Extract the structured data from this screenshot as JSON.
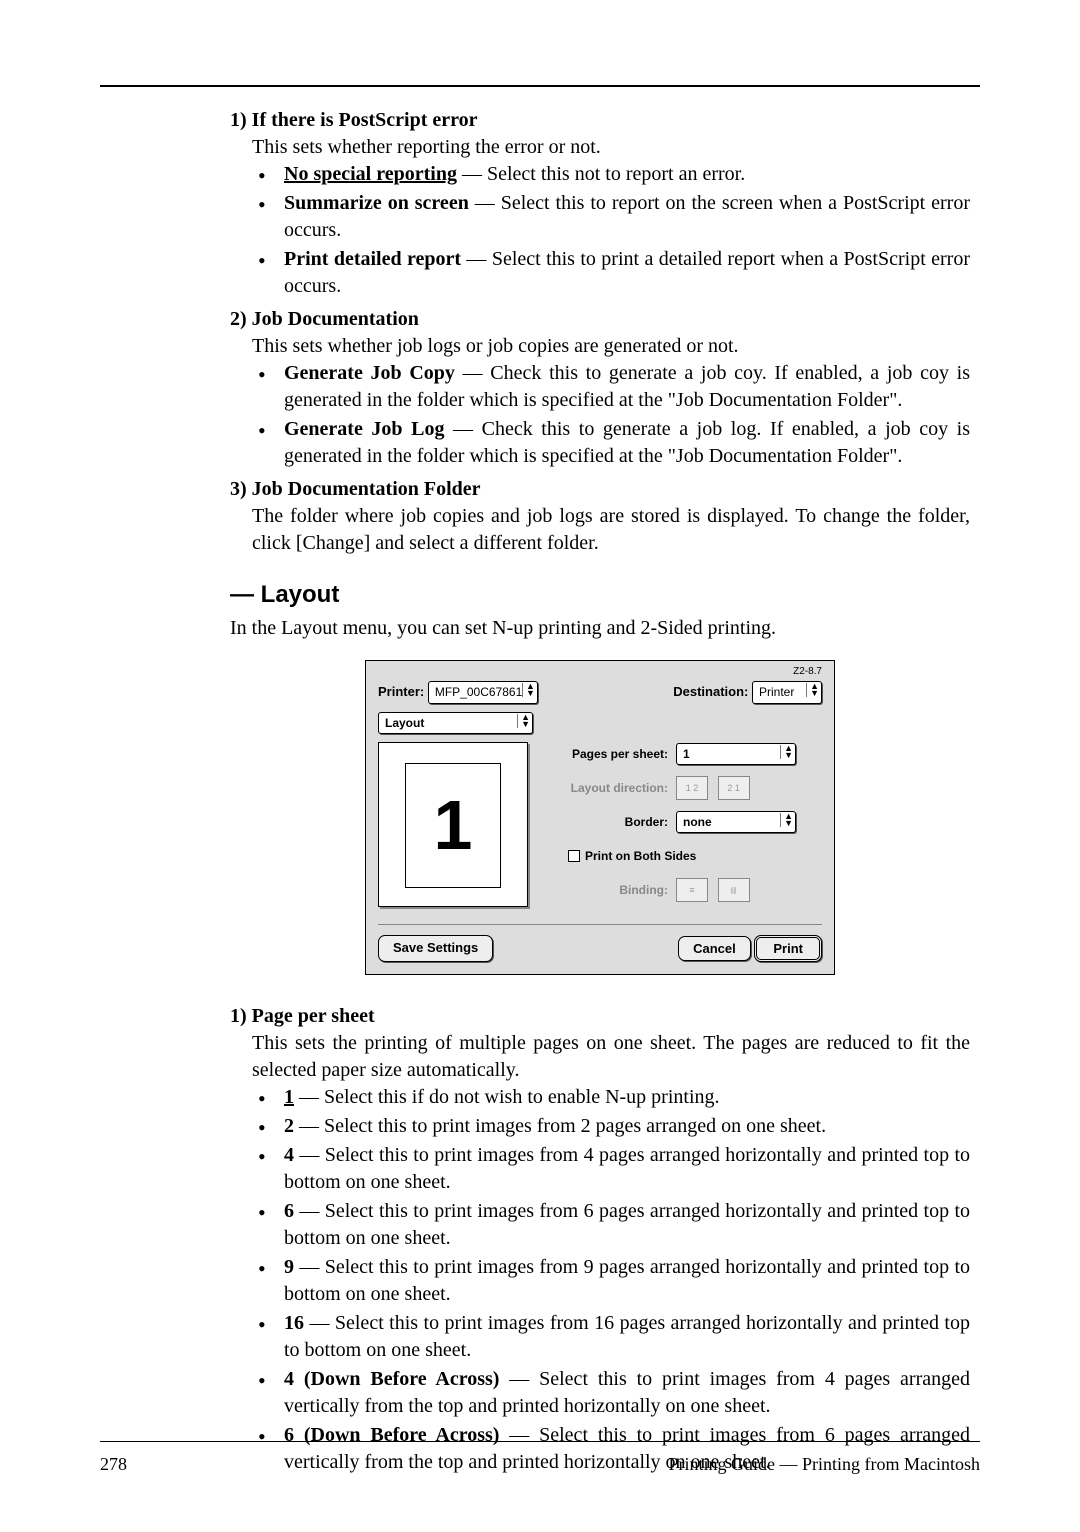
{
  "sec1": {
    "num": "1) ",
    "title": "If there is PostScript error",
    "desc": "This sets whether reporting the error or not.",
    "b1_bold": "No special reporting",
    "b1_rest": " — Select this not to report an error.",
    "b2_bold": "Summarize on screen",
    "b2_rest": " — Select this to report on the screen when a PostScript error occurs.",
    "b3_bold": "Print detailed report",
    "b3_rest": " — Select this to print a detailed report when a PostScript error occurs."
  },
  "sec2": {
    "num": "2) ",
    "title": "Job Documentation",
    "desc": "This sets whether job logs or job copies are generated or not.",
    "b1_bold": "Generate Job Copy",
    "b1_rest": " — Check this to generate a job coy.  If enabled, a job coy is generated in the folder which is specified at the \"Job Documentation Folder\".",
    "b2_bold": "Generate Job Log",
    "b2_rest": " — Check this to generate a job log.  If enabled, a job coy is generated in the folder which is specified at the \"Job Documentation Folder\"."
  },
  "sec3": {
    "num": "3) ",
    "title": "Job Documentation Folder",
    "desc": "The folder where job copies and job logs are stored is displayed.  To change the folder, click [Change] and select a different folder."
  },
  "layout": {
    "heading": "— Layout",
    "intro": "In the Layout menu, you can set N-up printing and 2-Sided printing."
  },
  "dialog": {
    "version": "Z2-8.7",
    "printer_label": "Printer:",
    "printer_value": "MFP_00C67861",
    "dest_label": "Destination:",
    "dest_value": "Printer",
    "panel": "Layout",
    "pages_label": "Pages per sheet:",
    "pages_value": "1",
    "dir_label": "Layout direction:",
    "dir_opt1": "1 2",
    "dir_opt2": "2 1",
    "border_label": "Border:",
    "border_value": "none",
    "both_label": "Print on Both Sides",
    "binding_label": "Binding:",
    "save_btn": "Save Settings",
    "cancel_btn": "Cancel",
    "print_btn": "Print",
    "preview_one": "1"
  },
  "pps": {
    "num": "1) ",
    "title": "Page per sheet",
    "desc": "This sets the printing of multiple pages on one sheet.  The pages are reduced to fit the selected paper size automatically.",
    "i1_bold": "1",
    "i1_rest": " — Select this if do not wish to enable N-up printing.",
    "i2_bold": "2",
    "i2_rest": " — Select this to print images from 2 pages arranged on one sheet.",
    "i3_bold": "4",
    "i3_rest": " — Select this to print images from 4 pages arranged horizontally and printed top to bottom on one sheet.",
    "i4_bold": "6",
    "i4_rest": " — Select this to print images from 6 pages arranged horizontally and printed top to bottom on one sheet.",
    "i5_bold": "9",
    "i5_rest": " — Select this to print images from 9 pages arranged horizontally and printed top to bottom on one sheet.",
    "i6_bold": "16",
    "i6_rest": " — Select this to print images from 16 pages arranged horizontally and printed top to bottom on one sheet.",
    "i7_bold": "4 (Down Before Across)",
    "i7_rest": " — Select this to print images from 4 pages arranged vertically from the top and printed horizontally on one sheet.",
    "i8_bold": "6 (Down Before Across)",
    "i8_rest": " — Select this to print images from 6 pages arranged vertically from the top and printed horizontally on one sheet."
  },
  "footer": {
    "page_num": "278",
    "title": "Printing Guide — Printing from Macintosh"
  }
}
